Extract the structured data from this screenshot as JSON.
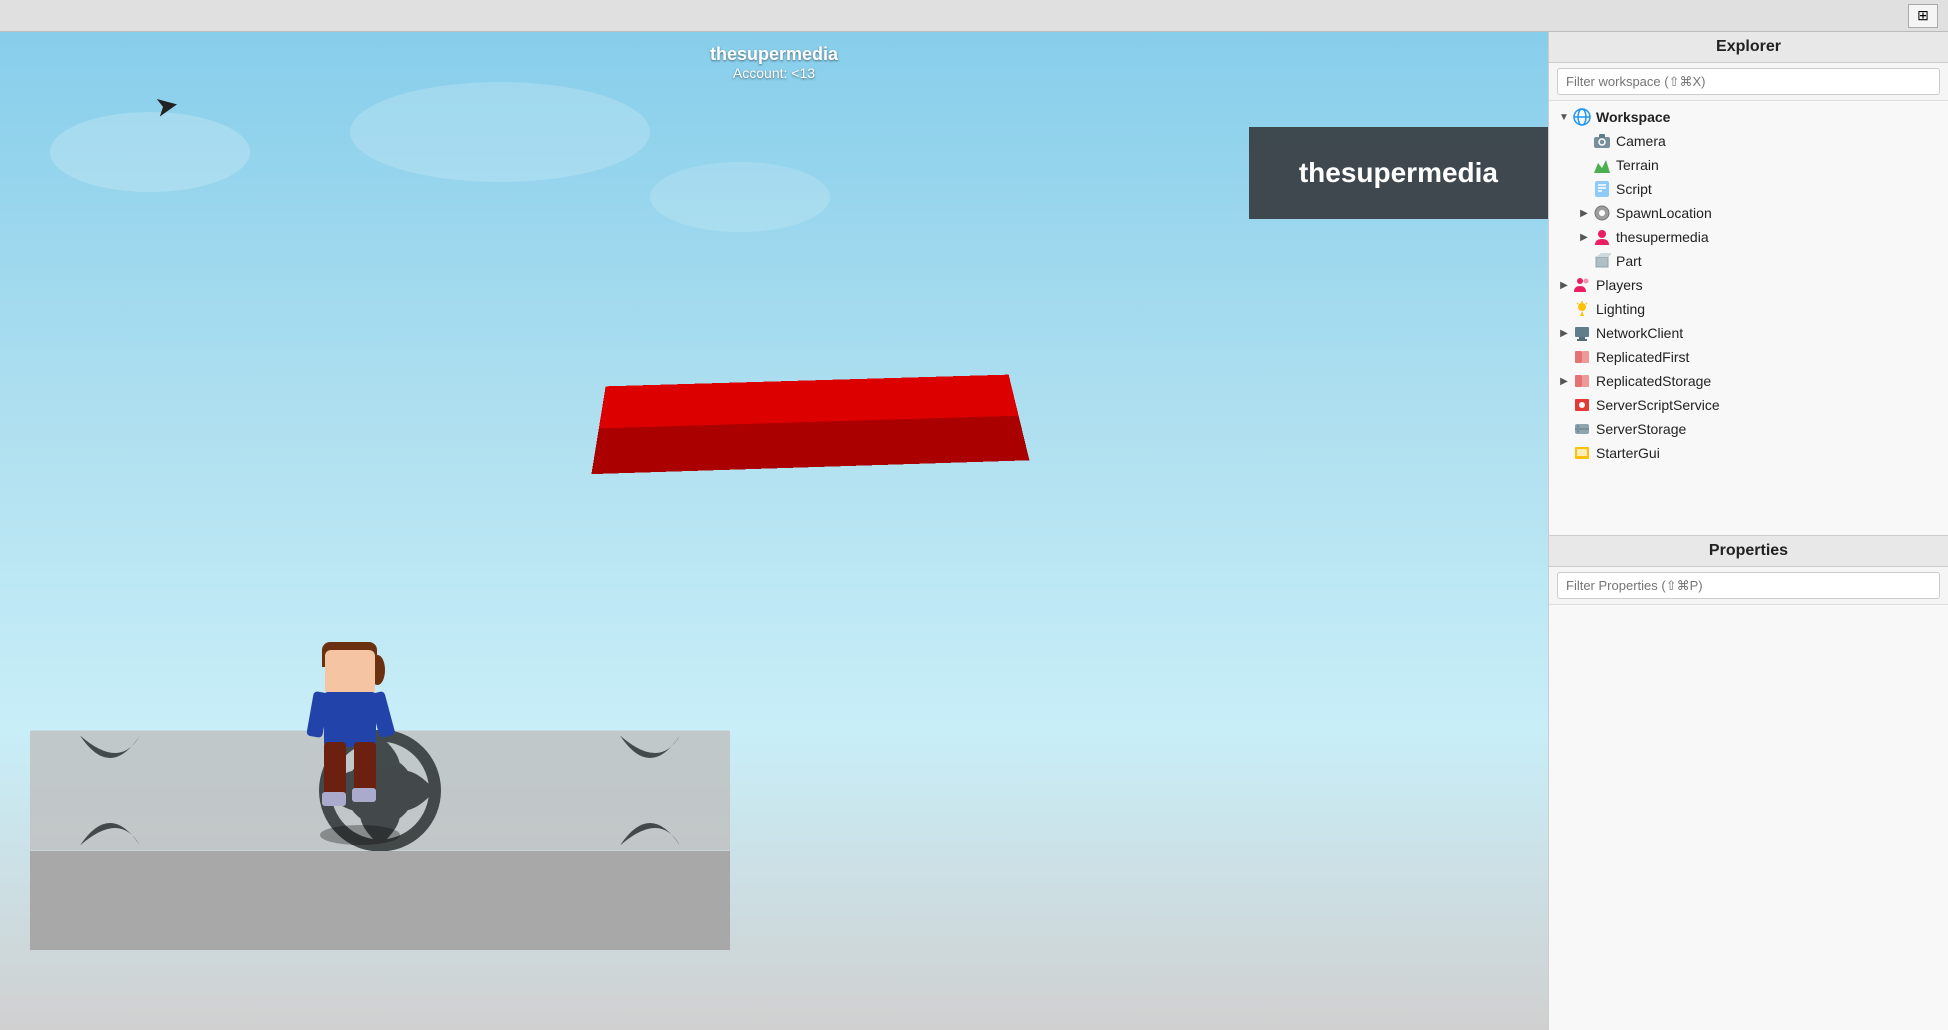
{
  "topbar": {
    "icon_label": "⊞"
  },
  "viewport": {
    "user_name": "thesupermedia",
    "account_label": "Account: <13",
    "username_panel": "thesupermedia",
    "cursor_symbol": "➤"
  },
  "explorer": {
    "header": "Explorer",
    "filter_placeholder": "Filter workspace (⇧⌘X)",
    "tree": [
      {
        "id": "workspace",
        "label": "Workspace",
        "indent": 0,
        "arrow": "▼",
        "icon": "🌐",
        "icon_class": "icon-globe",
        "bold": true
      },
      {
        "id": "camera",
        "label": "Camera",
        "indent": 2,
        "arrow": "",
        "icon": "📷",
        "icon_class": "icon-camera",
        "bold": false
      },
      {
        "id": "terrain",
        "label": "Terrain",
        "indent": 2,
        "arrow": "",
        "icon": "🏔",
        "icon_class": "icon-terrain",
        "bold": false
      },
      {
        "id": "script",
        "label": "Script",
        "indent": 2,
        "arrow": "",
        "icon": "📄",
        "icon_class": "icon-script",
        "bold": false
      },
      {
        "id": "spawnlocation",
        "label": "SpawnLocation",
        "indent": 2,
        "arrow": "▶",
        "icon": "⚙",
        "icon_class": "icon-spawn",
        "bold": false
      },
      {
        "id": "thesupermedia",
        "label": "thesupermedia",
        "indent": 2,
        "arrow": "▶",
        "icon": "👤",
        "icon_class": "icon-player",
        "bold": false
      },
      {
        "id": "part",
        "label": "Part",
        "indent": 2,
        "arrow": "",
        "icon": "◻",
        "icon_class": "icon-part",
        "bold": false
      },
      {
        "id": "players",
        "label": "Players",
        "indent": 0,
        "arrow": "▶",
        "icon": "👥",
        "icon_class": "icon-player",
        "bold": false
      },
      {
        "id": "lighting",
        "label": "Lighting",
        "indent": 0,
        "arrow": "",
        "icon": "💡",
        "icon_class": "icon-lighting",
        "bold": false
      },
      {
        "id": "networkclient",
        "label": "NetworkClient",
        "indent": 0,
        "arrow": "▶",
        "icon": "🖥",
        "icon_class": "icon-network",
        "bold": false
      },
      {
        "id": "replicatedfirst",
        "label": "ReplicatedFirst",
        "indent": 0,
        "arrow": "",
        "icon": "🔴",
        "icon_class": "icon-replicated",
        "bold": false
      },
      {
        "id": "replicatedstorage",
        "label": "ReplicatedStorage",
        "indent": 0,
        "arrow": "▶",
        "icon": "🔴",
        "icon_class": "icon-replicated",
        "bold": false
      },
      {
        "id": "serverscriptservice",
        "label": "ServerScriptService",
        "indent": 0,
        "arrow": "",
        "icon": "🔴",
        "icon_class": "icon-server",
        "bold": false
      },
      {
        "id": "serverstorage",
        "label": "ServerStorage",
        "indent": 0,
        "arrow": "",
        "icon": "🔲",
        "icon_class": "icon-storage",
        "bold": false
      },
      {
        "id": "startergui",
        "label": "StarterGui",
        "indent": 0,
        "arrow": "",
        "icon": "🟡",
        "icon_class": "icon-gui",
        "bold": false
      }
    ]
  },
  "properties": {
    "header": "Properties",
    "filter_placeholder": "Filter Properties (⇧⌘P)"
  }
}
